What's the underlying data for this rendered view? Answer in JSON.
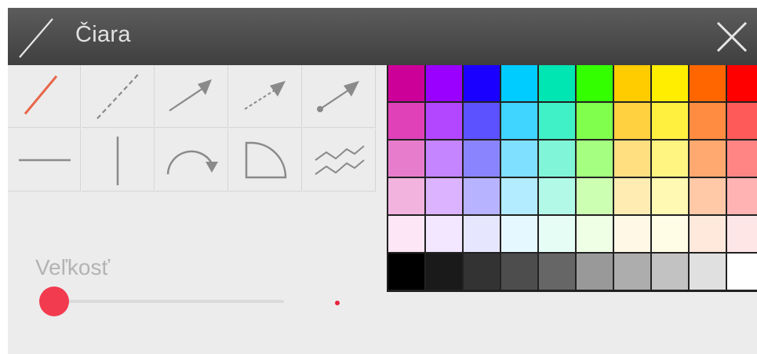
{
  "window": {
    "title": "Čiara",
    "title_icon": "line-icon",
    "close_icon": "close-icon"
  },
  "tools": [
    {
      "name": "line-solid",
      "icon": "line-solid-icon",
      "selected": true
    },
    {
      "name": "line-dashed",
      "icon": "line-dashed-icon",
      "selected": false
    },
    {
      "name": "arrow-solid",
      "icon": "arrow-solid-icon",
      "selected": false
    },
    {
      "name": "arrow-dashed",
      "icon": "arrow-dashed-icon",
      "selected": false
    },
    {
      "name": "arrow-dot-start",
      "icon": "arrow-dot-start-icon",
      "selected": false
    },
    {
      "name": "line-horizontal",
      "icon": "horizontal-line-icon",
      "selected": false
    },
    {
      "name": "line-vertical",
      "icon": "vertical-line-icon",
      "selected": false
    },
    {
      "name": "arc-arrow",
      "icon": "arc-arrow-icon",
      "selected": false
    },
    {
      "name": "quarter-circle",
      "icon": "quarter-circle-icon",
      "selected": false
    },
    {
      "name": "zigzag",
      "icon": "zigzag-lines-icon",
      "selected": false
    }
  ],
  "size": {
    "label": "Veľkosť",
    "value_fraction": 0.0
  },
  "colors": {
    "accent": "#f23b4f",
    "selected_tool": "#e8664a",
    "palette": [
      [
        "#cc0099",
        "#9900ff",
        "#1a00ff",
        "#00ccff",
        "#00e6b3",
        "#33ff00",
        "#ffcc00",
        "#ffee00",
        "#ff6600",
        "#ff0000"
      ],
      [
        "#e040b8",
        "#b347ff",
        "#5c52ff",
        "#40d5ff",
        "#40f0c6",
        "#80ff4d",
        "#ffd040",
        "#fff040",
        "#ff8c40",
        "#ff5a5a"
      ],
      [
        "#e87ccc",
        "#c585ff",
        "#8a85ff",
        "#7fe0ff",
        "#80f5d8",
        "#a5ff80",
        "#ffdf80",
        "#fff580",
        "#ffa870",
        "#ff8585"
      ],
      [
        "#f2b3df",
        "#dbb3ff",
        "#b8b3ff",
        "#b3ecff",
        "#b3f9e8",
        "#cdffb3",
        "#ffecb3",
        "#fff9b3",
        "#ffc9a8",
        "#ffb3b3"
      ],
      [
        "#fde6f6",
        "#f3e6ff",
        "#e6e6ff",
        "#e6f8ff",
        "#e6fdf6",
        "#eeffe6",
        "#fff8e6",
        "#fffde6",
        "#ffe8dc",
        "#ffe6e6"
      ],
      [
        "#000000",
        "#1a1a1a",
        "#333333",
        "#4d4d4d",
        "#666666",
        "#999999",
        "#adadad",
        "#c2c2c2",
        "#e0e0e0",
        "#ffffff"
      ]
    ]
  }
}
